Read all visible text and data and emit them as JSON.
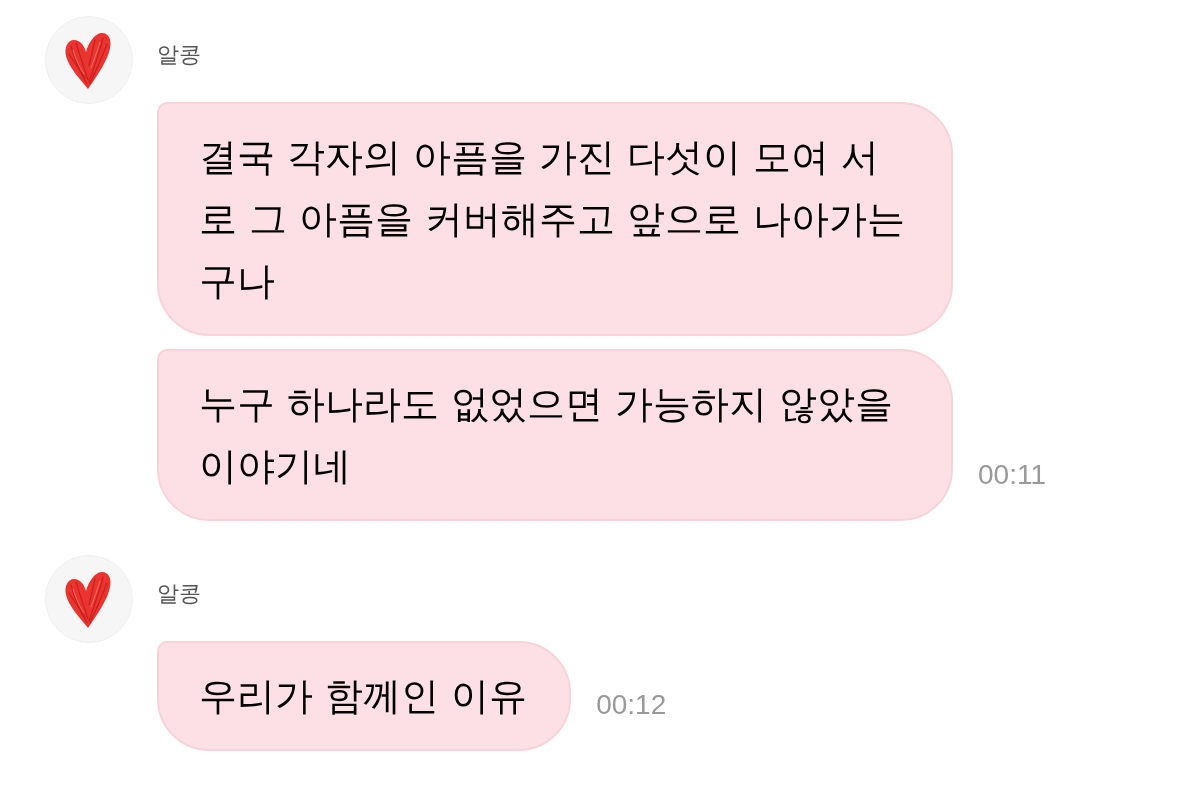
{
  "groups": [
    {
      "sender": "알콩",
      "messages": [
        {
          "text": "결국 각자의 아픔을 가진 다섯이 모여 서로 그 아픔을 커버해주고 앞으로 나아가는구나"
        },
        {
          "text": "누구 하나라도 없었으면 가능하지 않았을 이야기네",
          "time": "00:11"
        }
      ]
    },
    {
      "sender": "알콩",
      "messages": [
        {
          "text": "우리가 함께인 이유",
          "time": "00:12"
        }
      ]
    }
  ]
}
